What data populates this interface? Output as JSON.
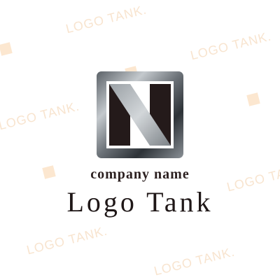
{
  "watermark": {
    "text": "LOGO TANK.",
    "color": "#f6dcc0"
  },
  "logo": {
    "company_name": "company name",
    "brand_name": "Logo Tank",
    "emblem_icon": "letter-n-in-metal-square-icon",
    "colors": {
      "text_dark": "#1f1717",
      "metal_light": "#c4c9cd",
      "metal_dark": "#2d3237"
    }
  }
}
